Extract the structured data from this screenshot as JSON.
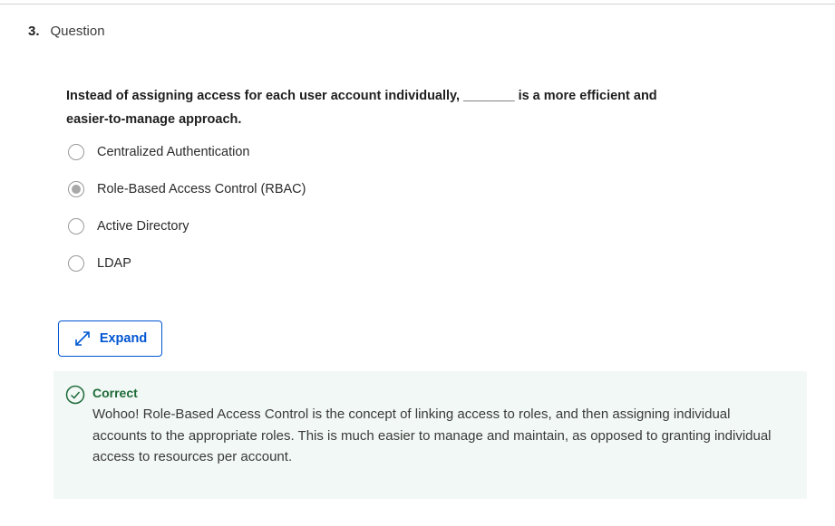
{
  "question": {
    "number": "3.",
    "label": "Question",
    "prompt": "Instead of assigning access for each user account individually, _______ is a more efficient and easier-to-manage approach."
  },
  "options": [
    {
      "label": "Centralized Authentication",
      "selected": false
    },
    {
      "label": "Role-Based Access Control (RBAC)",
      "selected": true
    },
    {
      "label": "Active Directory",
      "selected": false
    },
    {
      "label": "LDAP",
      "selected": false
    }
  ],
  "expand_button": {
    "label": "Expand",
    "icon": "expand-arrows-icon"
  },
  "feedback": {
    "status": "Correct",
    "icon": "check-circle-icon",
    "text": "Wohoo! Role-Based Access Control is the concept of linking access to roles, and then assigning individual accounts to the appropriate roles. This is much easier to manage and maintain, as opposed to granting individual access to resources per account."
  },
  "colors": {
    "accent": "#0056d2",
    "success": "#1f6b3a",
    "feedback_bg": "#f2f8f5"
  }
}
